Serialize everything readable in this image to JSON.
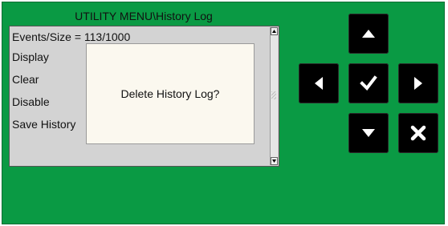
{
  "screen": {
    "title": "UTILITY MENU\\History Log",
    "menu": {
      "events_label": "Events/Size = 113/1000",
      "items": [
        "Display",
        "Clear",
        "Disable",
        "Save History"
      ]
    },
    "dialog": {
      "message": "Delete History Log?"
    }
  },
  "controls": {
    "up": "up-arrow-icon",
    "down": "down-arrow-icon",
    "left": "left-arrow-icon",
    "right": "right-arrow-icon",
    "ok": "checkmark-icon",
    "cancel": "x-icon"
  },
  "colors": {
    "background": "#0a9a44",
    "panel": "#d3d3d3",
    "dialog": "#fbf8ef",
    "button": "#000000"
  }
}
